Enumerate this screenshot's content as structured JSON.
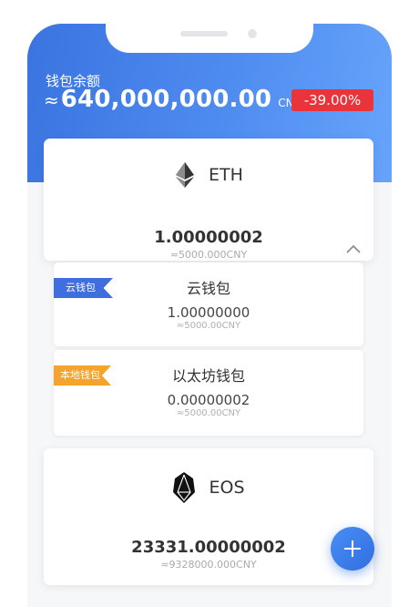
{
  "header": {
    "balance_label": "钱包余额",
    "approx_symbol": "≈",
    "balance_amount": "640,000,000.00",
    "currency": "CNY",
    "currency_caret": "▼",
    "change_badge": "-39.00%"
  },
  "colors": {
    "header_gradient_start": "#3a74e0",
    "header_gradient_end": "#66a4fb",
    "change_badge_bg": "#e8343a",
    "cloud_tag_bg": "#3f6ee0",
    "local_tag_bg": "#f3a42a",
    "fab_bg": "#3a7ef0"
  },
  "coins": [
    {
      "icon": "ethereum-icon",
      "symbol": "ETH",
      "amount": "1.00000002",
      "fiat": "≈5000.000CNY",
      "expanded": true,
      "collapse_icon": "chevron-up-icon",
      "wallets": [
        {
          "tag": "云钱包",
          "name": "云钱包",
          "amount": "1.00000000",
          "fiat": "≈5000.00CNY"
        },
        {
          "tag": "本地钱包",
          "name": "以太坊钱包",
          "amount": "0.00000002",
          "fiat": "≈5000.00CNY"
        }
      ]
    },
    {
      "icon": "eos-icon",
      "symbol": "EOS",
      "amount": "23331.00000002",
      "fiat": "≈9328000.000CNY",
      "expanded": false
    }
  ],
  "fab": {
    "icon": "plus-icon"
  }
}
